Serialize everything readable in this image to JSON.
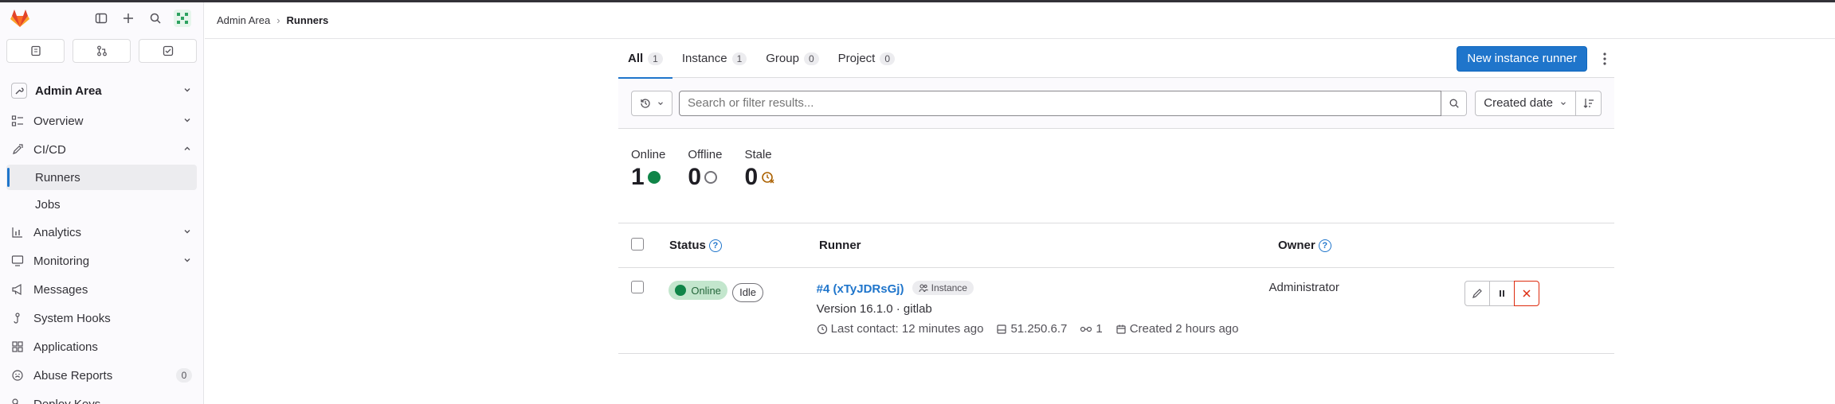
{
  "sidebar": {
    "section_title": "Admin Area",
    "items": [
      {
        "label": "Overview",
        "icon": "overview-icon"
      },
      {
        "label": "CI/CD",
        "icon": "rocket-icon"
      },
      {
        "label": "Analytics",
        "icon": "chart-icon"
      },
      {
        "label": "Monitoring",
        "icon": "monitor-icon"
      },
      {
        "label": "Messages",
        "icon": "bullhorn-icon"
      },
      {
        "label": "System Hooks",
        "icon": "hook-icon"
      },
      {
        "label": "Applications",
        "icon": "applications-icon"
      },
      {
        "label": "Abuse Reports",
        "icon": "abuse-icon",
        "count": "0"
      },
      {
        "label": "Deploy Keys",
        "icon": "key-icon"
      }
    ],
    "cicd_sub": [
      "Runners",
      "Jobs"
    ]
  },
  "breadcrumb": {
    "parent": "Admin Area",
    "current": "Runners"
  },
  "tabs": [
    {
      "label": "All",
      "count": "1"
    },
    {
      "label": "Instance",
      "count": "1"
    },
    {
      "label": "Group",
      "count": "0"
    },
    {
      "label": "Project",
      "count": "0"
    }
  ],
  "new_runner_label": "New instance runner",
  "search": {
    "placeholder": "Search or filter results..."
  },
  "sort": {
    "label": "Created date"
  },
  "stats": [
    {
      "label": "Online",
      "value": "1"
    },
    {
      "label": "Offline",
      "value": "0"
    },
    {
      "label": "Stale",
      "value": "0"
    }
  ],
  "table": {
    "headers": {
      "status": "Status",
      "runner": "Runner",
      "owner": "Owner"
    },
    "row": {
      "status": "Online",
      "state": "Idle",
      "runner_id": "#4 (xTyJDRsGj)",
      "type_badge": "Instance",
      "version": "Version 16.1.0 · gitlab",
      "last_contact": "Last contact: 12 minutes ago",
      "ip": "51.250.6.7",
      "jobs": "1",
      "created": "Created 2 hours ago",
      "owner": "Administrator"
    }
  },
  "colors": {
    "accent": "#1f75cb",
    "online": "#108548",
    "danger": "#dd2b0e"
  }
}
